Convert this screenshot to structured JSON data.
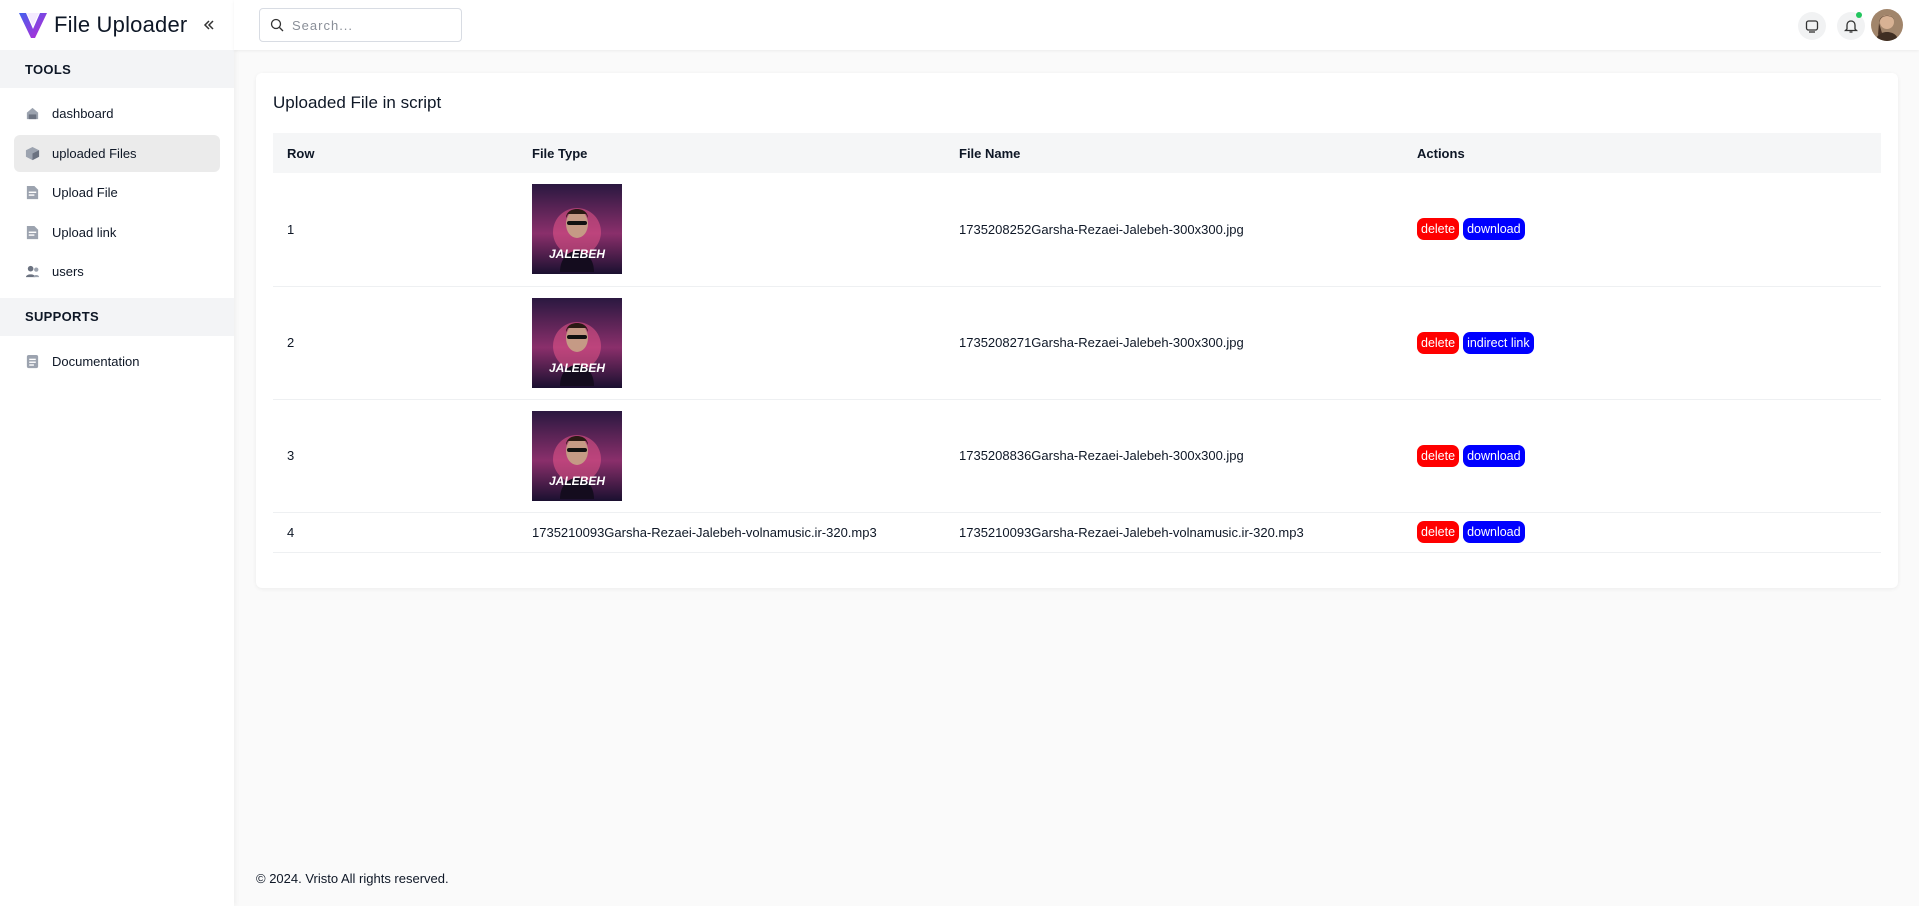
{
  "app": {
    "title": "File Uploader"
  },
  "header": {
    "search_placeholder": "Search..."
  },
  "sidebar": {
    "tools_heading": "TOOLS",
    "tools": [
      {
        "label": "dashboard",
        "icon": "home-icon",
        "active": false
      },
      {
        "label": "uploaded Files",
        "icon": "box-icon",
        "active": true
      },
      {
        "label": "Upload File",
        "icon": "file-icon",
        "active": false
      },
      {
        "label": "Upload link",
        "icon": "file-link-icon",
        "active": false
      },
      {
        "label": "users",
        "icon": "users-icon",
        "active": false
      }
    ],
    "supports_heading": "SUPPORTS",
    "supports": [
      {
        "label": "Documentation",
        "icon": "document-icon",
        "active": false
      }
    ]
  },
  "main": {
    "title": "Uploaded File in script",
    "columns": [
      "Row",
      "File Type",
      "File Name",
      "Actions"
    ],
    "rows": [
      {
        "row": "1",
        "type": "image",
        "type_text": "",
        "name": "1735208252Garsha-Rezaei-Jalebeh-300x300.jpg",
        "actions": [
          "delete",
          "download"
        ]
      },
      {
        "row": "2",
        "type": "image",
        "type_text": "",
        "name": "1735208271Garsha-Rezaei-Jalebeh-300x300.jpg",
        "actions": [
          "delete",
          "indirect link"
        ]
      },
      {
        "row": "3",
        "type": "image",
        "type_text": "",
        "name": "1735208836Garsha-Rezaei-Jalebeh-300x300.jpg",
        "actions": [
          "delete",
          "download"
        ]
      },
      {
        "row": "4",
        "type": "text",
        "type_text": "1735210093Garsha-Rezaei-Jalebeh-volnamusic.ir-320.mp3",
        "name": "1735210093Garsha-Rezaei-Jalebeh-volnamusic.ir-320.mp3",
        "actions": [
          "delete",
          "download"
        ]
      }
    ],
    "thumbnail_text": "JALEBEH"
  },
  "footer": {
    "text": "© 2024. Vristo All rights reserved."
  },
  "colors": {
    "delete": "#ff0000",
    "action": "#0000ff",
    "brand": "#805dca",
    "online": "#22c55e"
  }
}
